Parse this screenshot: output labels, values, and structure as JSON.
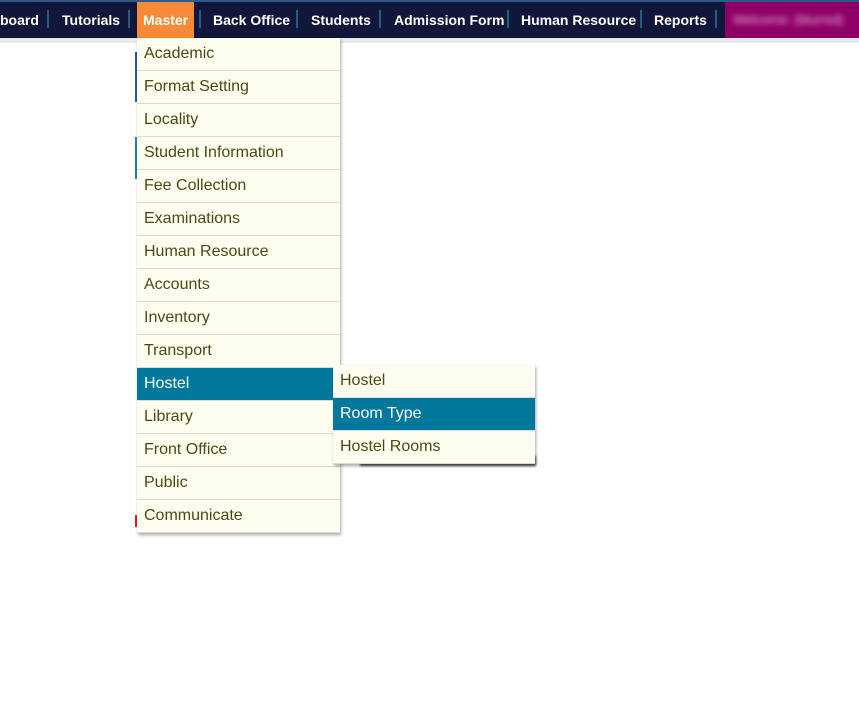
{
  "nav": {
    "items": [
      {
        "label": "board",
        "active": false
      },
      {
        "label": "Tutorials",
        "active": false
      },
      {
        "label": "Master",
        "active": true
      },
      {
        "label": "Back Office",
        "active": false
      },
      {
        "label": "Students",
        "active": false
      },
      {
        "label": "Admission Form",
        "active": false
      },
      {
        "label": "Human Resource",
        "active": false
      },
      {
        "label": "Reports",
        "active": false
      }
    ],
    "welcome": "Welcome: (blurred)"
  },
  "master_menu": {
    "items": [
      "Academic",
      "Format Setting",
      "Locality",
      "Student Information",
      "Fee Collection",
      "Examinations",
      "Human Resource",
      "Accounts",
      "Inventory",
      "Transport",
      "Hostel",
      "Library",
      "Front Office",
      "Public",
      "Communicate"
    ],
    "selected": "Hostel"
  },
  "hostel_submenu": {
    "items": [
      "Hostel",
      "Room Type",
      "Hostel Rooms"
    ],
    "selected": "Room Type"
  },
  "colors": {
    "nav_bg": "#11173b",
    "active_tab": "#f68a39",
    "selected_item": "#00789c",
    "menu_bg": "#fefef0",
    "welcome_bg": "#8e0066"
  }
}
